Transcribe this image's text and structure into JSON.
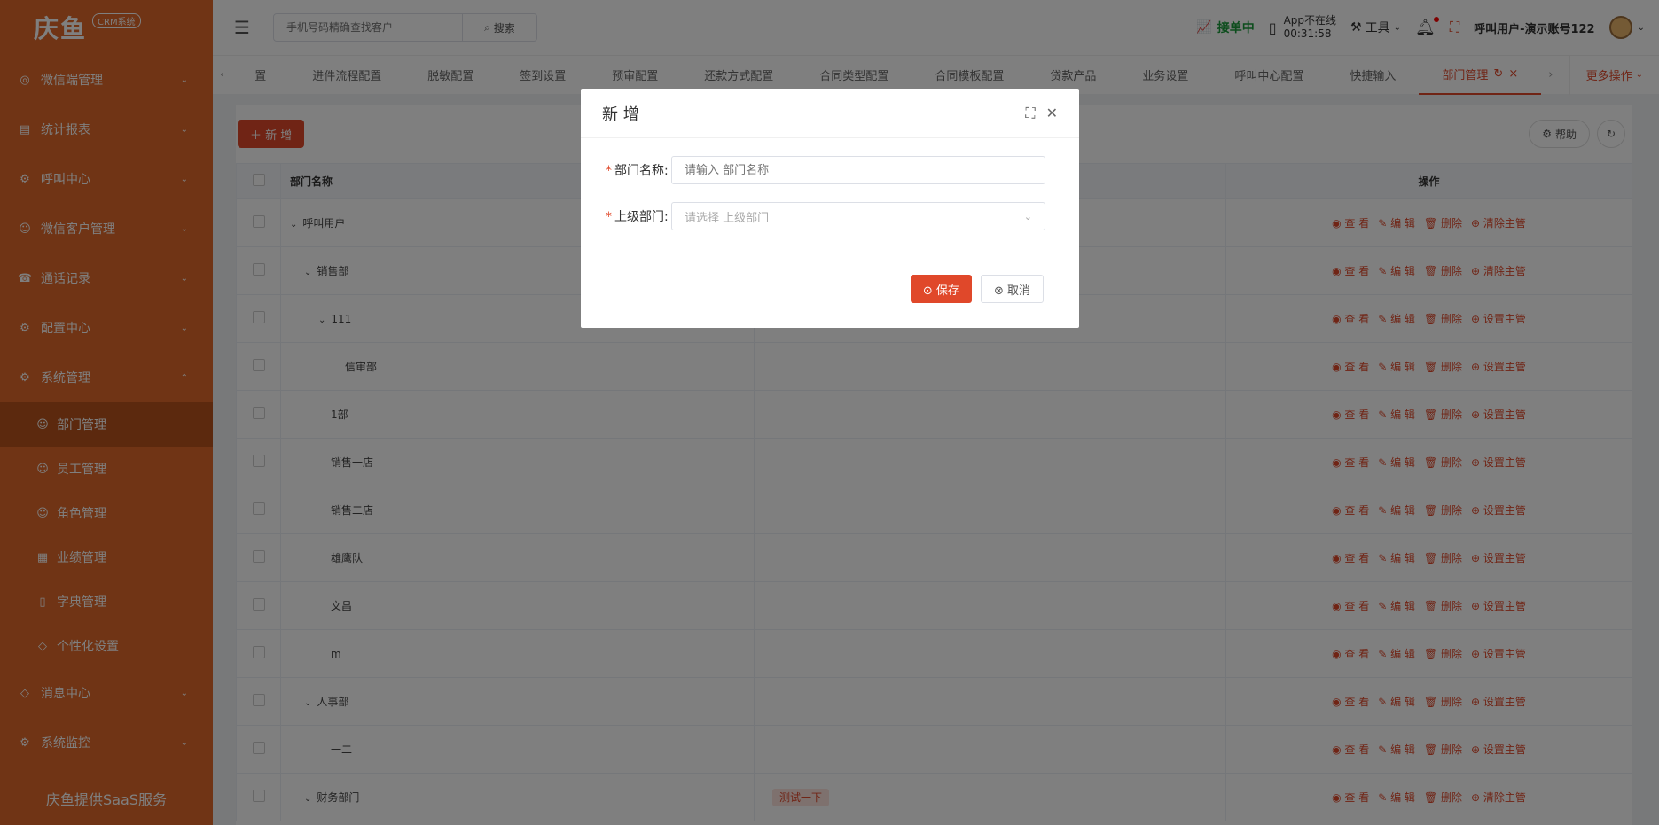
{
  "brand": {
    "name": "庆鱼",
    "tag": "CRM系统"
  },
  "sidebar": {
    "groups": [
      {
        "label": "微信端管理",
        "icon": "chat-icon"
      },
      {
        "label": "统计报表",
        "icon": "report-icon"
      },
      {
        "label": "呼叫中心",
        "icon": "settings-icon"
      },
      {
        "label": "微信客户管理",
        "icon": "user-icon"
      },
      {
        "label": "通话记录",
        "icon": "phone-icon"
      },
      {
        "label": "配置中心",
        "icon": "settings-icon"
      },
      {
        "label": "系统管理",
        "icon": "settings-icon"
      }
    ],
    "sub_items": [
      {
        "label": "部门管理",
        "icon": "user-icon"
      },
      {
        "label": "员工管理",
        "icon": "user-icon"
      },
      {
        "label": "角色管理",
        "icon": "user-icon"
      },
      {
        "label": "业绩管理",
        "icon": "grid-icon"
      },
      {
        "label": "字典管理",
        "icon": "book-icon"
      },
      {
        "label": "个性化设置",
        "icon": "tag-icon"
      }
    ],
    "bottom_groups": [
      {
        "label": "消息中心",
        "icon": "tag-icon"
      },
      {
        "label": "系统监控",
        "icon": "settings-icon"
      }
    ],
    "footer": "庆鱼提供SaaS服务"
  },
  "header": {
    "search_placeholder": "手机号码精确查找客户",
    "search_button": "搜索",
    "status": "接单中",
    "app_status_line1": "App不在线",
    "app_status_line2": "00:31:58",
    "tools": "工具",
    "username": "呼叫用户-演示账号122"
  },
  "tabs": {
    "items": [
      "置",
      "进件流程配置",
      "脱敏配置",
      "签到设置",
      "预审配置",
      "还款方式配置",
      "合同类型配置",
      "合同模板配置",
      "贷款产品",
      "业务设置",
      "呼叫中心配置",
      "快捷输入"
    ],
    "active": "部门管理",
    "more": "更多操作"
  },
  "toolbar": {
    "add": "新 增",
    "help": "帮助"
  },
  "table": {
    "headers": {
      "name": "部门名称",
      "ops": "操作"
    },
    "rows": [
      {
        "name": "呼叫用户",
        "indent": 0,
        "expand": true,
        "tag": "",
        "last_op": "清除主管"
      },
      {
        "name": "销售部",
        "indent": 1,
        "expand": true,
        "tag": "",
        "last_op": "清除主管"
      },
      {
        "name": "111",
        "indent": 2,
        "expand": true,
        "tag": "",
        "last_op": "设置主管"
      },
      {
        "name": "信审部",
        "indent": 3,
        "expand": false,
        "tag": "",
        "last_op": "设置主管"
      },
      {
        "name": "1部",
        "indent": 2,
        "expand": false,
        "tag": "",
        "last_op": "设置主管"
      },
      {
        "name": "销售一店",
        "indent": 2,
        "expand": false,
        "tag": "",
        "last_op": "设置主管"
      },
      {
        "name": "销售二店",
        "indent": 2,
        "expand": false,
        "tag": "",
        "last_op": "设置主管"
      },
      {
        "name": "雄鹰队",
        "indent": 2,
        "expand": false,
        "tag": "",
        "last_op": "设置主管"
      },
      {
        "name": "文昌",
        "indent": 2,
        "expand": false,
        "tag": "",
        "last_op": "设置主管"
      },
      {
        "name": "m",
        "indent": 2,
        "expand": false,
        "tag": "",
        "last_op": "设置主管"
      },
      {
        "name": "人事部",
        "indent": 1,
        "expand": true,
        "tag": "",
        "last_op": "设置主管"
      },
      {
        "name": "一二",
        "indent": 2,
        "expand": false,
        "tag": "",
        "last_op": "设置主管"
      },
      {
        "name": "财务部门",
        "indent": 1,
        "expand": true,
        "tag": "测试一下",
        "last_op": "清除主管"
      }
    ],
    "op_view": "查 看",
    "op_edit": "编 辑",
    "op_delete": "删除"
  },
  "modal": {
    "title": "新 增",
    "dept_label": "部门名称:",
    "dept_placeholder": "请输入 部门名称",
    "parent_label": "上级部门:",
    "parent_placeholder": "请选择 上级部门",
    "save": "保存",
    "cancel": "取消"
  }
}
